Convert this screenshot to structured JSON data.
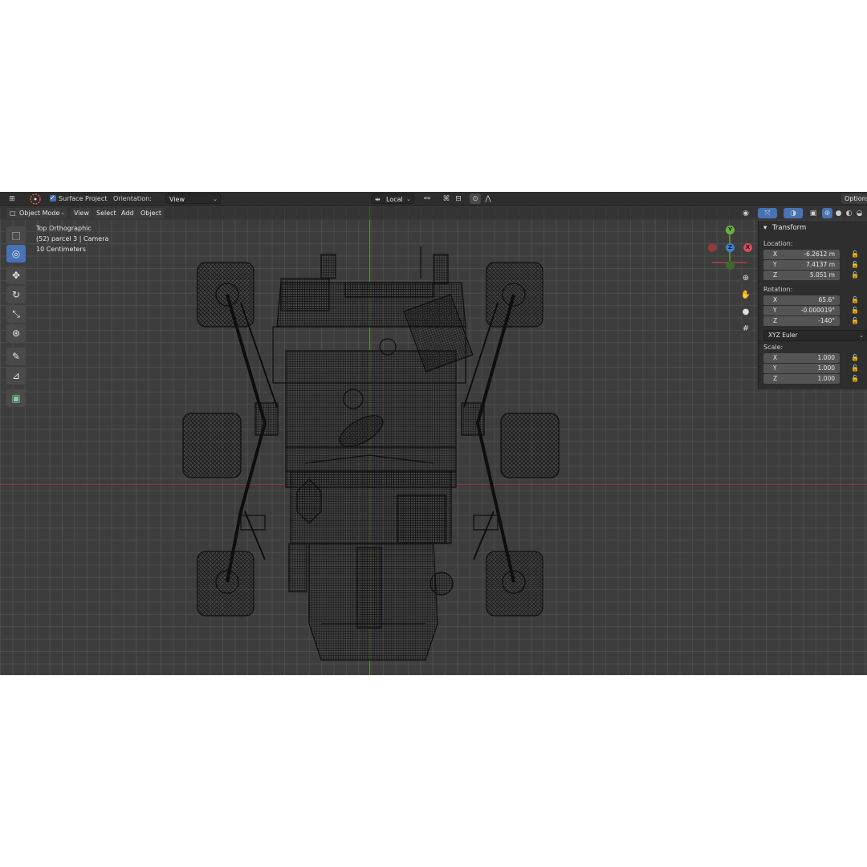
{
  "tool_header": {
    "surface_project_label": "Surface Project",
    "orientation_label": "Orientation:",
    "orientation_value": "View",
    "pivot_value": "Local",
    "options_label": "Options"
  },
  "view_header": {
    "mode": "Object Mode",
    "menus": [
      "View",
      "Select",
      "Add",
      "Object"
    ]
  },
  "viewport_info": {
    "view_name": "Top Orthographic",
    "object_info": "(52) parcel 3 | Camera",
    "scale_text": "10 Centimeters"
  },
  "gizmo": {
    "y": "Y",
    "x": "X",
    "z": "Z"
  },
  "transform_panel": {
    "title": "Transform",
    "location_label": "Location:",
    "location": [
      {
        "axis": "X",
        "value": "-6.2612 m"
      },
      {
        "axis": "Y",
        "value": "7.4137 m"
      },
      {
        "axis": "Z",
        "value": "5.051 m"
      }
    ],
    "rotation_label": "Rotation:",
    "rotation": [
      {
        "axis": "X",
        "value": "65.6°"
      },
      {
        "axis": "Y",
        "value": "-0.000019°"
      },
      {
        "axis": "Z",
        "value": "-140°"
      }
    ],
    "rotation_mode": "XYZ Euler",
    "scale_label": "Scale:",
    "scale": [
      {
        "axis": "X",
        "value": "1.000"
      },
      {
        "axis": "Y",
        "value": "1.000"
      },
      {
        "axis": "Z",
        "value": "1.000"
      }
    ]
  },
  "colors": {
    "accent": "#4772b3",
    "axis_x": "#8a3a3f",
    "axis_y": "#5a8a2a",
    "wire": "#0e0e0e"
  }
}
